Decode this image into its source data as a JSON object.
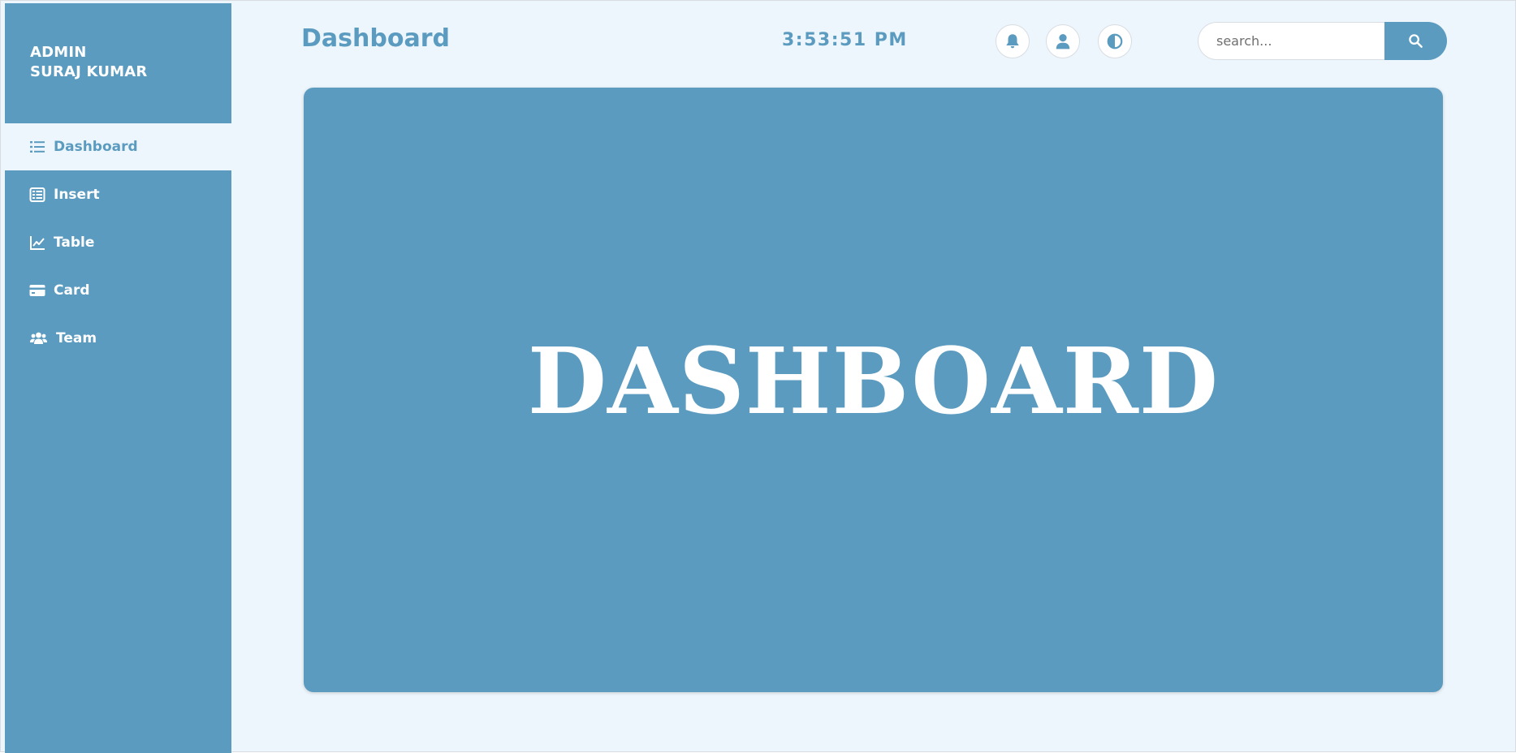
{
  "sidebar": {
    "admin_line1": "ADMIN",
    "admin_line2": "SURAJ KUMAR",
    "items": [
      {
        "label": "Dashboard",
        "icon": "list-icon",
        "active": true
      },
      {
        "label": "Insert",
        "icon": "table-list-icon",
        "active": false
      },
      {
        "label": "Table",
        "icon": "line-chart-icon",
        "active": false
      },
      {
        "label": "Card",
        "icon": "credit-card-icon",
        "active": false
      },
      {
        "label": "Team",
        "icon": "users-icon",
        "active": false
      }
    ]
  },
  "header": {
    "title": "Dashboard",
    "clock": "3:53:51 PM",
    "icons": [
      "bell-icon",
      "user-icon",
      "contrast-icon"
    ]
  },
  "search": {
    "placeholder": "search...",
    "value": ""
  },
  "main": {
    "heading": "DASHBOARD"
  },
  "colors": {
    "accent": "#5b9bc0",
    "background": "#eef6fd",
    "white": "#ffffff"
  }
}
